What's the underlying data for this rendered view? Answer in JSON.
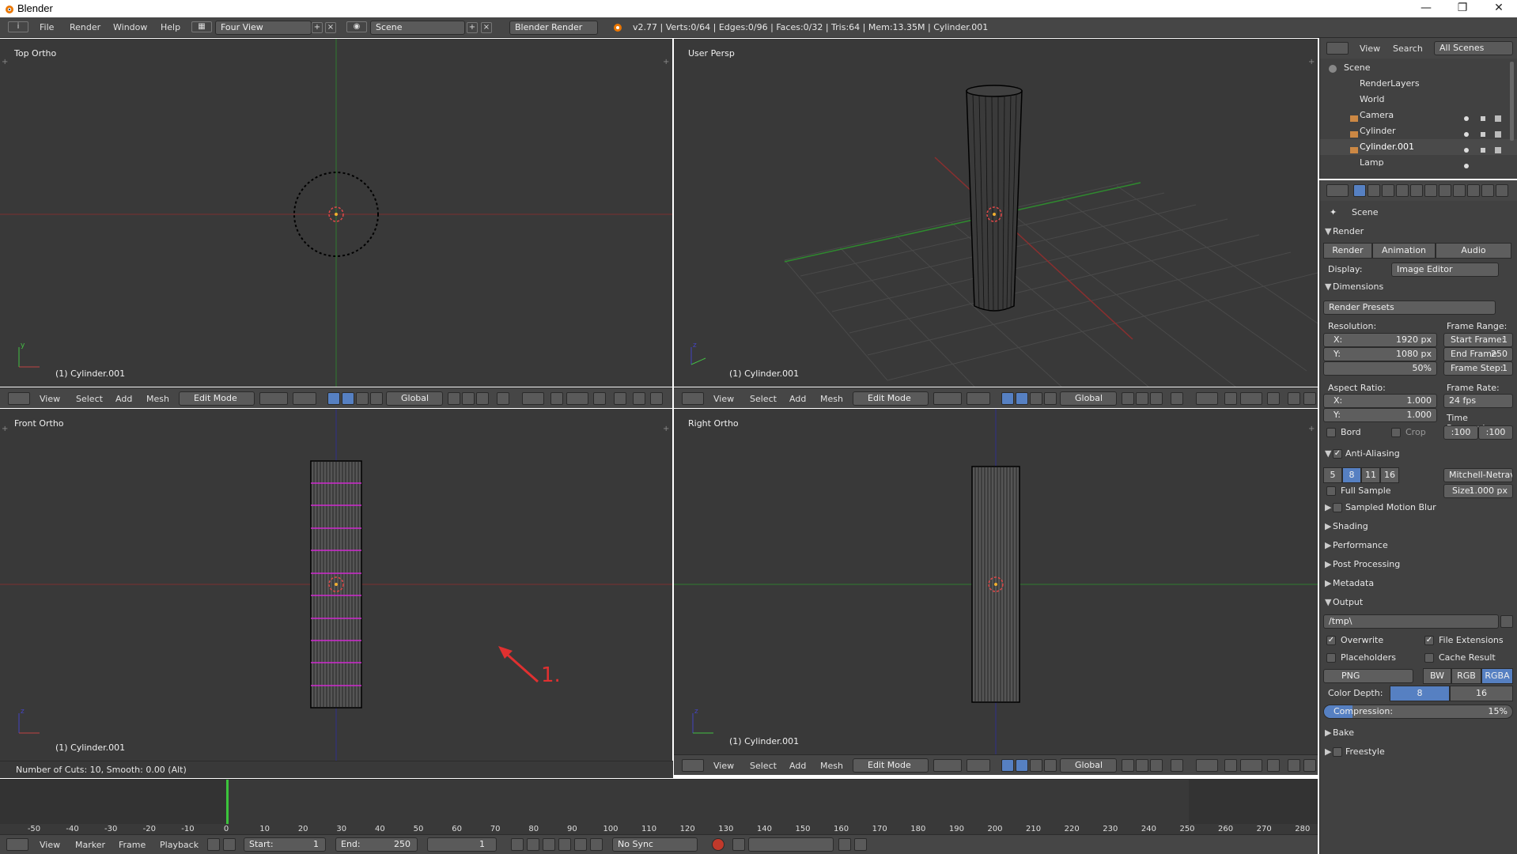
{
  "window": {
    "title": "Blender"
  },
  "menu": {
    "items": [
      "File",
      "Render",
      "Window",
      "Help"
    ],
    "layout": "Four View",
    "scene": "Scene",
    "engine": "Blender Render",
    "stats": "v2.77 | Verts:0/64 | Edges:0/96 | Faces:0/32 | Tris:64 | Mem:13.35M | Cylinder.001"
  },
  "viewports": {
    "top_left": {
      "label": "Top Ortho",
      "object": "(1) Cylinder.001"
    },
    "top_right": {
      "label": "User Persp",
      "object": "(1) Cylinder.001"
    },
    "bottom_left": {
      "label": "Front Ortho",
      "object": "(1) Cylinder.001",
      "annotation": "1."
    },
    "bottom_right": {
      "label": "Right Ortho",
      "object": "(1) Cylinder.001"
    }
  },
  "view_header": {
    "view": "View",
    "select": "Select",
    "add": "Add",
    "mesh": "Mesh",
    "mode": "Edit Mode",
    "orientation": "Global"
  },
  "operator": {
    "text": "Number of Cuts: 10, Smooth: 0.00 (Alt)"
  },
  "timeline": {
    "ticks": [
      "-50",
      "-40",
      "-30",
      "-20",
      "-10",
      "0",
      "10",
      "20",
      "30",
      "40",
      "50",
      "60",
      "70",
      "80",
      "90",
      "100",
      "110",
      "120",
      "130",
      "140",
      "150",
      "160",
      "170",
      "180",
      "190",
      "200",
      "210",
      "220",
      "230",
      "240",
      "250",
      "260",
      "270",
      "280"
    ],
    "current": "1",
    "footer": {
      "view": "View",
      "marker": "Marker",
      "frame": "Frame",
      "playback": "Playback",
      "start_label": "Start:",
      "start": "1",
      "end_label": "End:",
      "end": "250",
      "frame_value": "1",
      "sync": "No Sync"
    }
  },
  "outliner": {
    "header": {
      "view": "View",
      "search": "Search",
      "filter": "All Scenes"
    },
    "items": [
      {
        "name": "Scene"
      },
      {
        "name": "RenderLayers"
      },
      {
        "name": "World"
      },
      {
        "name": "Camera"
      },
      {
        "name": "Cylinder"
      },
      {
        "name": "Cylinder.001"
      },
      {
        "name": "Lamp"
      }
    ]
  },
  "properties": {
    "context": "Scene",
    "render": {
      "title": "Render",
      "render_btn": "Render",
      "animation_btn": "Animation",
      "audio_btn": "Audio",
      "display_label": "Display:",
      "display_value": "Image Editor"
    },
    "dimensions": {
      "title": "Dimensions",
      "presets": "Render Presets",
      "resolution_label": "Resolution:",
      "x_label": "X:",
      "x_value": "1920 px",
      "y_label": "Y:",
      "y_value": "1080 px",
      "percent": "50%",
      "frame_range_label": "Frame Range:",
      "start_frame_label": "Start Frame:",
      "start_frame": "1",
      "end_frame_label": "End Frame:",
      "end_frame": "250",
      "frame_step_label": "Frame Step:",
      "frame_step": "1",
      "aspect_label": "Aspect Ratio:",
      "ax_label": "X:",
      "ax_value": "1.000",
      "ay_label": "Y:",
      "ay_value": "1.000",
      "frame_rate_label": "Frame Rate:",
      "frame_rate": "24 fps",
      "time_remap_label": "Time Remapping:",
      "remap_old": ":100",
      "remap_new": ":100",
      "bord": "Bord",
      "crop": "Crop"
    },
    "antialiasing": {
      "title": "Anti-Aliasing",
      "samples": [
        "5",
        "8",
        "11",
        "16"
      ],
      "selected": "8",
      "filter": "Mitchell-Netravali",
      "full_sample": "Full Sample",
      "size_label": "Size:",
      "size_value": "1.000 px"
    },
    "collapsed": [
      "Sampled Motion Blur",
      "Shading",
      "Performance",
      "Post Processing",
      "Metadata"
    ],
    "output": {
      "title": "Output",
      "path": "/tmp\\",
      "overwrite": "Overwrite",
      "file_extensions": "File Extensions",
      "placeholders": "Placeholders",
      "cache_result": "Cache Result",
      "format": "PNG",
      "bw": "BW",
      "rgb": "RGB",
      "rgba": "RGBA",
      "color_depth_label": "Color Depth:",
      "depth_8": "8",
      "depth_16": "16",
      "compression_label": "Compression:",
      "compression": "15%"
    },
    "bake": "Bake",
    "freestyle": "Freestyle"
  },
  "colors": {
    "bg_view": "#393939",
    "header": "#464646",
    "selected": "#5680c2",
    "x_axis": "#8a2d2d",
    "y_axis": "#2f8a2f",
    "annotation": "#e03030",
    "loopcut": "#d02ad0"
  }
}
